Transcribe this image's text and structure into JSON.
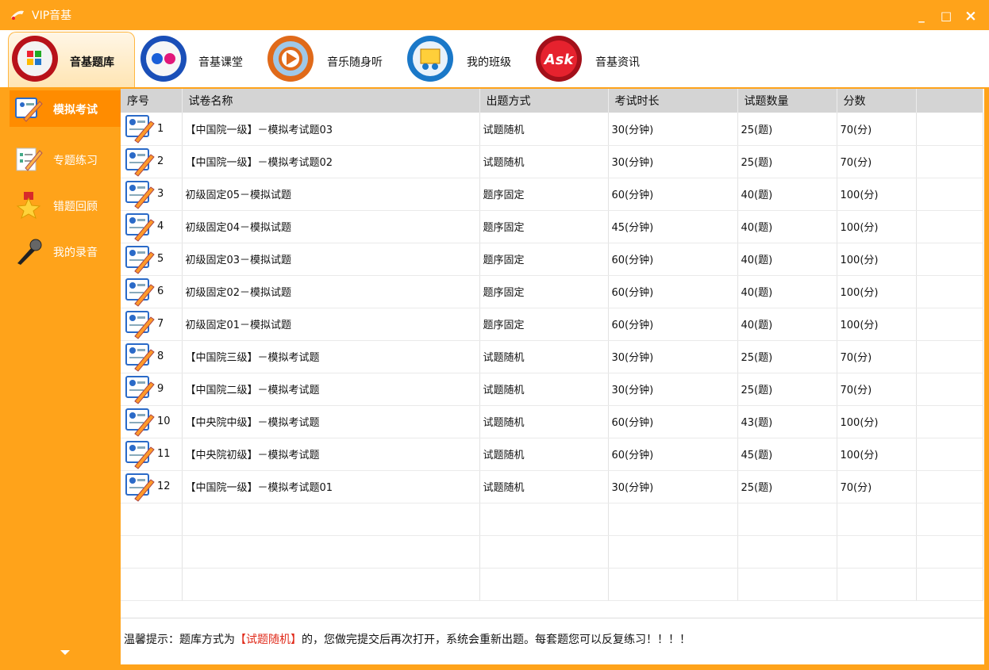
{
  "window": {
    "title": "VIP音基",
    "minimize": "_",
    "maximize": "□",
    "close": "×"
  },
  "topnav": {
    "tabs": [
      {
        "label": "音基题库",
        "icon": "question-bank-icon",
        "active": true
      },
      {
        "label": "音基课堂",
        "icon": "classroom-icon"
      },
      {
        "label": "音乐随身听",
        "icon": "music-player-icon"
      },
      {
        "label": "我的班级",
        "icon": "my-class-icon"
      },
      {
        "label": "音基资讯",
        "icon": "news-icon"
      }
    ]
  },
  "sidebar": {
    "items": [
      {
        "label": "模拟考试",
        "icon": "mock-exam-icon",
        "active": true
      },
      {
        "label": "专题练习",
        "icon": "topic-practice-icon"
      },
      {
        "label": "错题回顾",
        "icon": "wrong-review-icon"
      },
      {
        "label": "我的录音",
        "icon": "microphone-icon"
      }
    ]
  },
  "table": {
    "headers": [
      "序号",
      "试卷名称",
      "出题方式",
      "考试时长",
      "试题数量",
      "分数"
    ],
    "rows": [
      {
        "seq": "1",
        "name": "【中国院一级】－模拟考试题03",
        "mode": "试题随机",
        "duration": "30(分钟)",
        "count": "25(题)",
        "score": "70(分)"
      },
      {
        "seq": "2",
        "name": "【中国院一级】－模拟考试题02",
        "mode": "试题随机",
        "duration": "30(分钟)",
        "count": "25(题)",
        "score": "70(分)"
      },
      {
        "seq": "3",
        "name": "初级固定05－模拟试题",
        "mode": "题序固定",
        "duration": "60(分钟)",
        "count": "40(题)",
        "score": "100(分)"
      },
      {
        "seq": "4",
        "name": "初级固定04－模拟试题",
        "mode": "题序固定",
        "duration": "45(分钟)",
        "count": "40(题)",
        "score": "100(分)"
      },
      {
        "seq": "5",
        "name": "初级固定03－模拟试题",
        "mode": "题序固定",
        "duration": "60(分钟)",
        "count": "40(题)",
        "score": "100(分)"
      },
      {
        "seq": "6",
        "name": "初级固定02－模拟试题",
        "mode": "题序固定",
        "duration": "60(分钟)",
        "count": "40(题)",
        "score": "100(分)"
      },
      {
        "seq": "7",
        "name": "初级固定01－模拟试题",
        "mode": "题序固定",
        "duration": "60(分钟)",
        "count": "40(题)",
        "score": "100(分)"
      },
      {
        "seq": "8",
        "name": "【中国院三级】－模拟考试题",
        "mode": "试题随机",
        "duration": "30(分钟)",
        "count": "25(题)",
        "score": "70(分)"
      },
      {
        "seq": "9",
        "name": "【中国院二级】－模拟考试题",
        "mode": "试题随机",
        "duration": "30(分钟)",
        "count": "25(题)",
        "score": "70(分)"
      },
      {
        "seq": "10",
        "name": "【中央院中级】－模拟考试题",
        "mode": "试题随机",
        "duration": "60(分钟)",
        "count": "43(题)",
        "score": "100(分)"
      },
      {
        "seq": "11",
        "name": "【中央院初级】－模拟考试题",
        "mode": "试题随机",
        "duration": "60(分钟)",
        "count": "45(题)",
        "score": "100(分)"
      },
      {
        "seq": "12",
        "name": "【中国院一级】－模拟考试题01",
        "mode": "试题随机",
        "duration": "30(分钟)",
        "count": "25(题)",
        "score": "70(分)"
      }
    ]
  },
  "tip": {
    "prefix": "温馨提示：题库方式为",
    "highlight": "【试题随机】",
    "suffix": "的，您做完提交后再次打开，系统会重新出题。每套题您可以反复练习！！！！"
  },
  "colors": {
    "accent": "#ffa31a",
    "active": "#ff8c00",
    "highlight": "#e02a1a"
  }
}
